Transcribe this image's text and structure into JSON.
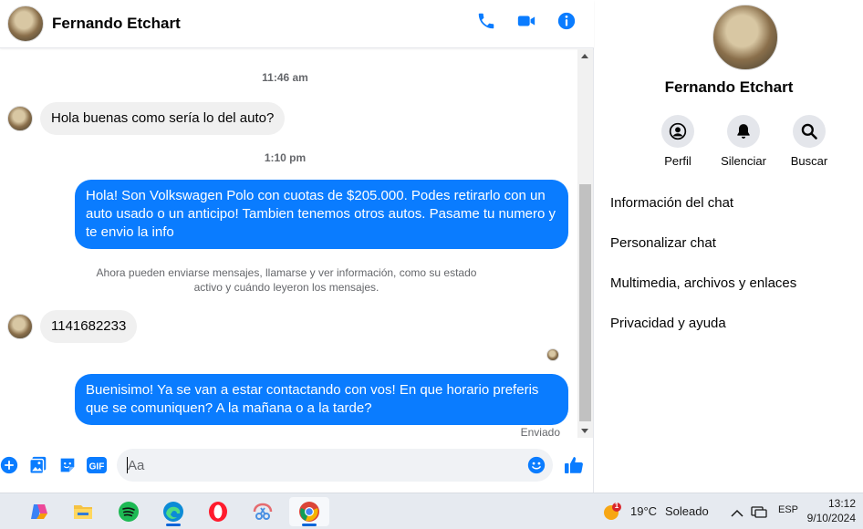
{
  "header": {
    "contact_name": "Fernando Etchart"
  },
  "messages": {
    "time1": "11:46 am",
    "in1": "Hola buenas como sería lo del auto?",
    "time2": "1:10 pm",
    "out1": "Hola! Son Volkswagen Polo con cuotas de $205.000. Podes retirarlo con un auto usado o un anticipo! Tambien tenemos otros autos. Pasame tu numero y te envio la info",
    "notice": "Ahora pueden enviarse mensajes, llamarse y ver información, como su estado activo y cuándo leyeron los mensajes.",
    "in2": "1141682233",
    "out2": "Buenisimo! Ya se van a estar contactando con vos! En que horario preferis que se comuniquen? A la mañana o a la tarde?",
    "status": "Enviado"
  },
  "composer": {
    "placeholder": "Aa",
    "gif_label": "GIF"
  },
  "panel": {
    "name": "Fernando Etchart",
    "buttons": [
      "Perfil",
      "Silenciar",
      "Buscar"
    ],
    "menu": [
      "Información del chat",
      "Personalizar chat",
      "Multimedia, archivos y enlaces",
      "Privacidad y ayuda"
    ]
  },
  "taskbar": {
    "weather_temp": "19°C",
    "weather_desc": "Soleado",
    "weather_badge": "1",
    "lang": "ESP",
    "time": "13:12",
    "date": "9/10/2024"
  },
  "colors": {
    "accent": "#0a7cff",
    "bubble_in": "#f0f0f0"
  }
}
